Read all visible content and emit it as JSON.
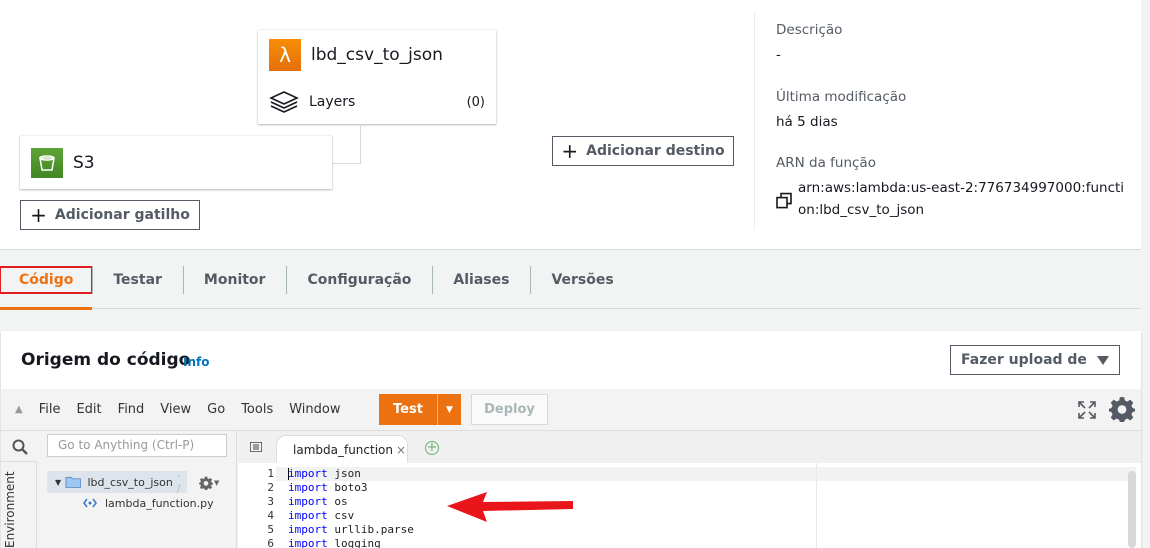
{
  "designer": {
    "function_name": "lbd_csv_to_json",
    "layers_label": "Layers",
    "layers_count": "(0)",
    "trigger_name": "S3",
    "add_trigger_label": "Adicionar gatilho",
    "add_destination_label": "Adicionar destino"
  },
  "details": {
    "description_label": "Descrição",
    "description_value": "-",
    "last_modified_label": "Última modificação",
    "last_modified_value": "há 5 dias",
    "arn_label": "ARN da função",
    "arn_value": "arn:aws:lambda:us-east-2:776734997000:function:lbd_csv_to_json"
  },
  "tabs": [
    {
      "label": "Código",
      "active": true
    },
    {
      "label": "Testar"
    },
    {
      "label": "Monitor"
    },
    {
      "label": "Configuração"
    },
    {
      "label": "Aliases"
    },
    {
      "label": "Versões"
    }
  ],
  "code_source": {
    "title": "Origem do código",
    "info_label": "Info",
    "upload_label": "Fazer upload de"
  },
  "ide": {
    "menu": [
      "File",
      "Edit",
      "Find",
      "View",
      "Go",
      "Tools",
      "Window"
    ],
    "test_label": "Test",
    "deploy_label": "Deploy",
    "goto_placeholder": "Go to Anything (Ctrl-P)",
    "environment_label": "Environment",
    "folder_name": "lbd_csv_to_json",
    "folder_suffix": "- /",
    "file_name": "lambda_function.py",
    "open_tab": "lambda_function",
    "code_lines": [
      {
        "num": "1",
        "kw": "import",
        "rest": " json"
      },
      {
        "num": "2",
        "kw": "import",
        "rest": " boto3"
      },
      {
        "num": "3",
        "kw": "import",
        "rest": " os"
      },
      {
        "num": "4",
        "kw": "import",
        "rest": " csv"
      },
      {
        "num": "5",
        "kw": "import",
        "rest": " urllib.parse"
      },
      {
        "num": "6",
        "kw": "import",
        "rest": " logging"
      }
    ]
  },
  "colors": {
    "accent": "#ec7211",
    "link": "#0073bb",
    "highlight_box": "#e02020",
    "arrow": "#e8161a"
  },
  "icons": [
    "lambda-icon",
    "layers-icon",
    "s3-bucket-icon",
    "plus-icon",
    "copy-icon",
    "search-icon",
    "gear-icon",
    "expand-icon",
    "folder-icon",
    "python-file-icon",
    "caret-down-icon"
  ]
}
